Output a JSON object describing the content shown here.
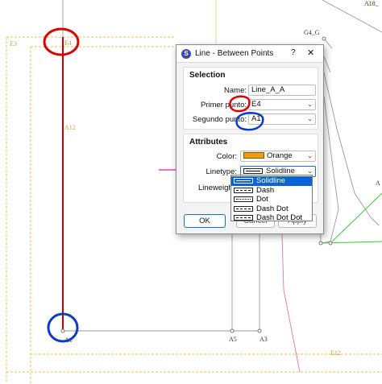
{
  "drawing": {
    "labels": {
      "a18": "A18_",
      "g4g": "G4_G",
      "e3": "E3",
      "e4": "E4",
      "a12": "A12",
      "a1": "A1",
      "a5": "A5",
      "a3": "A3",
      "e12": "E12",
      "a_right": "A"
    },
    "colors": {
      "line_red": "#cc0000",
      "outline_orange": "#f0c040",
      "annotation_red": "#e00000",
      "annotation_blue": "#0b3cc8",
      "annotation_pink": "#ff66cc",
      "green": "#33cc33",
      "pink_line": "#e070c0"
    }
  },
  "dialog": {
    "title": "Line - Between Points",
    "help_label": "?",
    "close_icon": "close-icon",
    "selection": {
      "heading": "Selection",
      "name_label": "Name:",
      "name_value": "Line_A_A",
      "first_point_label": "Primer punto:",
      "first_point_value": "E4",
      "second_point_label": "Segundo punto:",
      "second_point_value": "A1"
    },
    "attributes": {
      "heading": "Attributes",
      "color_label": "Color:",
      "color_value": "Orange",
      "color_swatch": "#f39c12",
      "linetype_label": "Linetype:",
      "linetype_value": "Solidline",
      "lineweight_label": "Lineweight:"
    },
    "buttons": {
      "ok": "OK",
      "cancel_partial": "Cancel",
      "apply_partial": "Apply"
    }
  },
  "linetype_options": [
    "Solidline",
    "Dash",
    "Dot",
    "Dash Dot",
    "Dash Dot Dot"
  ]
}
